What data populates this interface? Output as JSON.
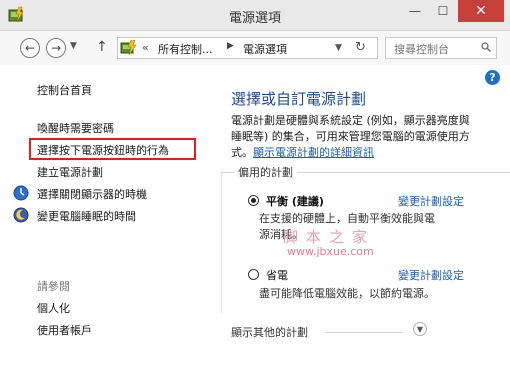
{
  "window": {
    "title": "電源選項",
    "minimize_glyph": "—",
    "maximize_glyph": "☐",
    "close_glyph": "✕"
  },
  "nav": {
    "back_glyph": "←",
    "forward_glyph": "→",
    "dropdown_glyph": "▼",
    "up_glyph": "↑",
    "address": {
      "overflow": "«",
      "crumbs": [
        "所有控制...",
        "電源選項"
      ],
      "separator_glyph": "▶",
      "dropdown_glyph": "▼",
      "refresh_glyph": "↻"
    },
    "search_placeholder": "搜尋控制台"
  },
  "left_pane": {
    "home_link": "控制台首頁",
    "items": [
      {
        "label": "喚醒時需要密碼",
        "icon": "none"
      },
      {
        "label": "選擇按下電源按鈕時的行為",
        "icon": "none",
        "highlighted": true
      },
      {
        "label": "建立電源計劃",
        "icon": "none"
      },
      {
        "label": "選擇關閉顯示器的時機",
        "icon": "display-icon"
      },
      {
        "label": "變更電腦睡眠的時間",
        "icon": "moon-icon"
      }
    ],
    "see_also_label": "請參閱",
    "see_also": [
      "個人化",
      "使用者帳戶"
    ]
  },
  "main": {
    "help_glyph": "?",
    "heading": "選擇或自訂電源計劃",
    "description_lines": [
      "電源計劃是硬體與系統設定 (例如，顯示器亮度與",
      "睡眠等) 的集合，可用來管理您電腦的電源使用方",
      "式。"
    ],
    "description_link": "顯示電源計劃的詳細資訊",
    "group_title": "偏用的計劃",
    "plans": [
      {
        "name": "平衡 (建議)",
        "selected": true,
        "change_link": "變更計劃設定",
        "description_lines": [
          "在支援的硬體上，自動平衡效能與電",
          "源消耗。"
        ]
      },
      {
        "name": "省電",
        "selected": false,
        "change_link": "變更計劃設定",
        "description_lines": [
          "盡可能降低電腦效能，以節約電源。"
        ]
      }
    ],
    "show_more": "顯示其他的計劃",
    "expand_glyph": "▼"
  },
  "watermark": {
    "chars": "脚本之家",
    "url": "www.jbxue.com"
  },
  "colors": {
    "accent_link": "#1a5fb4",
    "heading": "#1f4e8c",
    "highlight_box": "#e02020",
    "close_button": "#c7403a"
  }
}
